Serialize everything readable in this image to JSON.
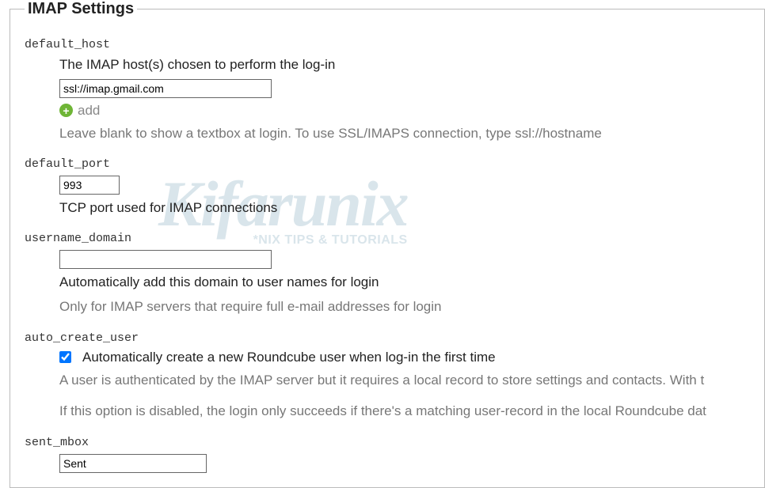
{
  "legend": "IMAP Settings",
  "watermark": {
    "big": "Kifarunix",
    "small": "*NIX TIPS & TUTORIALS"
  },
  "settings": {
    "default_host": {
      "key": "default_host",
      "desc": "The IMAP host(s) chosen to perform the log-in",
      "value": "ssl://imap.gmail.com",
      "add_label": "add",
      "hint": "Leave blank to show a textbox at login. To use SSL/IMAPS connection, type ssl://hostname"
    },
    "default_port": {
      "key": "default_port",
      "value": "993",
      "desc": "TCP port used for IMAP connections"
    },
    "username_domain": {
      "key": "username_domain",
      "value": "",
      "desc": "Automatically add this domain to user names for login",
      "hint": "Only for IMAP servers that require full e-mail addresses for login"
    },
    "auto_create_user": {
      "key": "auto_create_user",
      "checked": true,
      "label": "Automatically create a new Roundcube user when log-in the first time",
      "hint1": "A user is authenticated by the IMAP server but it requires a local record to store settings and contacts. With t",
      "hint2": "If this option is disabled, the login only succeeds if there's a matching user-record in the local Roundcube dat"
    },
    "sent_mbox": {
      "key": "sent_mbox",
      "value": "Sent"
    }
  }
}
